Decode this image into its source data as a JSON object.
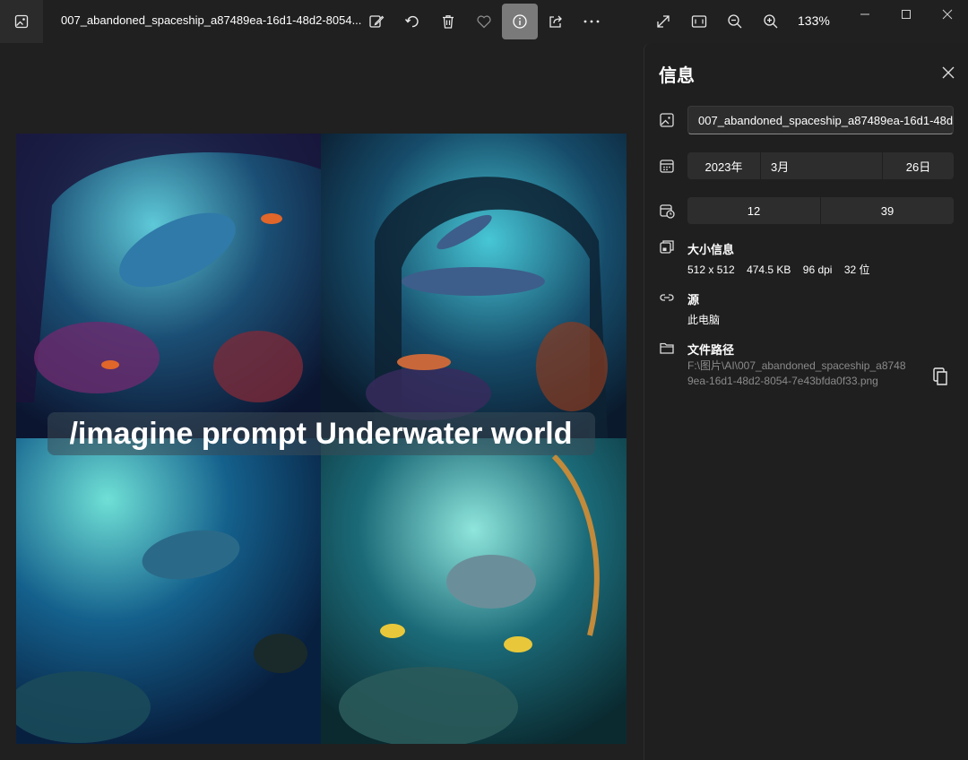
{
  "titlebar": {
    "filename": "007_abandoned_spaceship_a87489ea-16d1-48d2-8054...",
    "zoom": "133%",
    "icons": [
      "photos-app-icon",
      "edit-icon",
      "rotate-icon",
      "delete-icon",
      "favorite-icon",
      "info-icon",
      "share-icon",
      "more-icon",
      "fullscreen-icon",
      "fit-icon",
      "zoom-out-icon",
      "zoom-in-icon",
      "minimize-icon",
      "maximize-icon",
      "close-icon"
    ]
  },
  "image": {
    "caption": "/imagine prompt Underwater world"
  },
  "panel": {
    "title": "信息",
    "file_name": "007_abandoned_spaceship_a87489ea-16d1-48d2-8054-7e43bfda0f33.png",
    "date": {
      "year": "2023年",
      "month": "3月",
      "day": "26日"
    },
    "time": {
      "hour": "12",
      "minute": "39"
    },
    "size_section": {
      "title": "大小信息",
      "dimensions": "512 x 512",
      "file_size": "474.5 KB",
      "dpi": "96 dpi",
      "bit_depth": "32 位"
    },
    "source_section": {
      "title": "源",
      "value": "此电脑"
    },
    "path_section": {
      "title": "文件路径",
      "value": "F:\\图片\\AI\\007_abandoned_spaceship_a87489ea-16d1-48d2-8054-7e43bfda0f33.png"
    }
  },
  "colors": {
    "background": "#202020",
    "panel": "#1f1f1f",
    "field": "#2d2d2d",
    "active_button": "#7a7a7a",
    "muted_text": "#8a8a8a"
  }
}
